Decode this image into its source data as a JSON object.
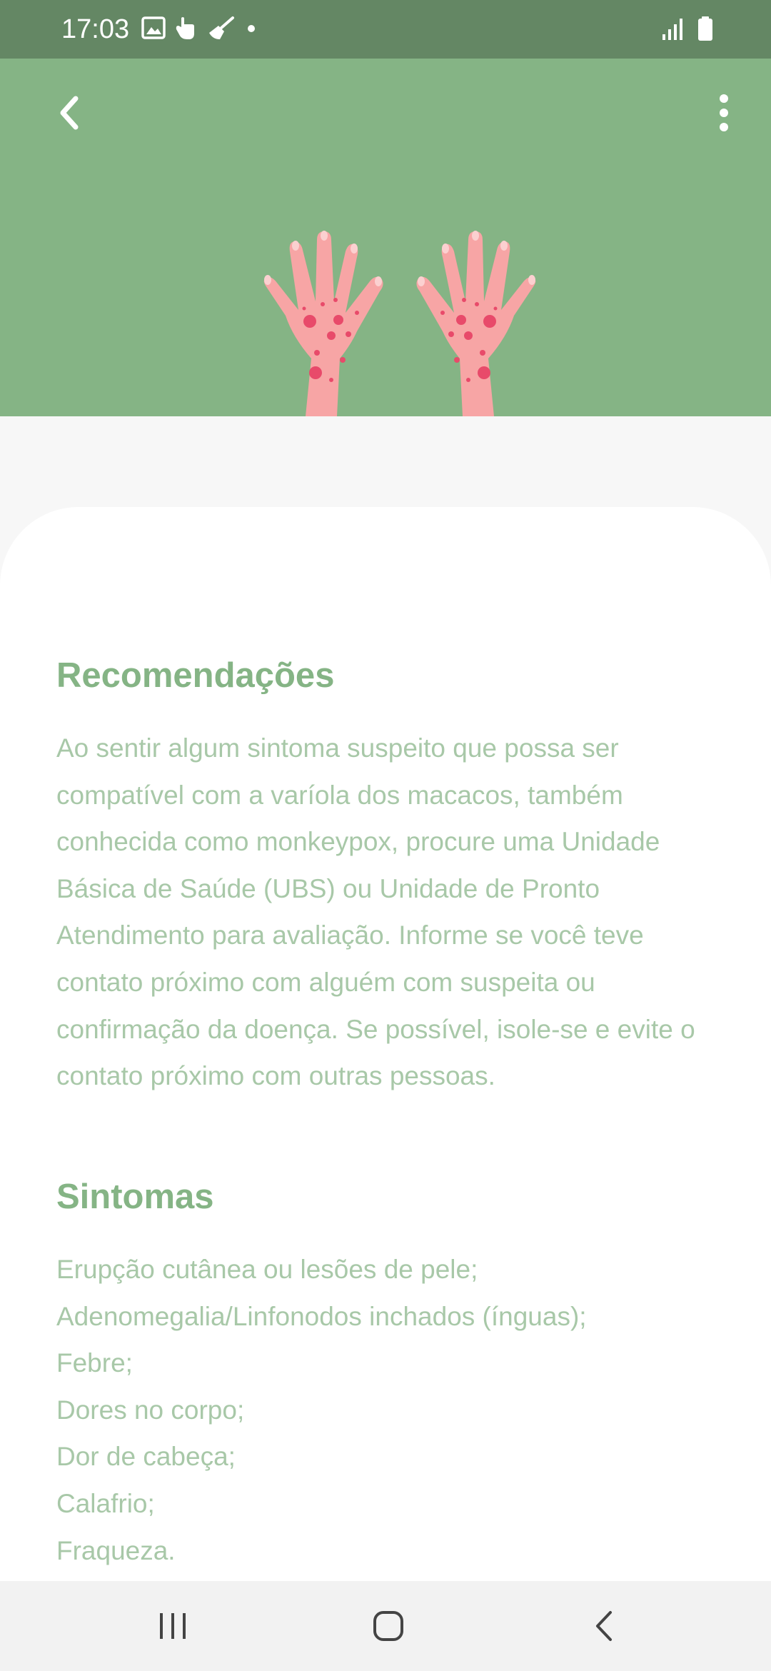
{
  "status_bar": {
    "time": "17:03",
    "icons_left": [
      "image-icon",
      "hand-icon",
      "broom-icon",
      "dot-icon"
    ],
    "icons_right": [
      "signal-icon",
      "battery-icon"
    ]
  },
  "header": {
    "back_icon": "chevron-left-icon",
    "menu_icon": "more-vertical-icon",
    "illustration": "hands-with-rash-illustration"
  },
  "recommendations": {
    "title": "Recomendações",
    "body": "Ao sentir algum sintoma suspeito que possa ser compatível com a varíola dos macacos, também conhecida como monkeypox, procure uma Unidade Básica de Saúde (UBS) ou Unidade de Pronto Atendimento para avaliação. Informe se você teve contato próximo com alguém com suspeita ou confirmação da doença. Se possível, isole-se e evite o contato próximo com outras pessoas."
  },
  "symptoms": {
    "title": "Sintomas",
    "items": [
      "Erupção cutânea ou lesões de pele;",
      "Adenomegalia/Linfonodos inchados (ínguas);",
      "Febre;",
      "Dores no corpo;",
      "Dor de cabeça;",
      "Calafrio;",
      "Fraqueza."
    ]
  },
  "nav_bar": {
    "buttons": [
      "recents-icon",
      "home-icon",
      "back-icon"
    ]
  },
  "colors": {
    "status_bar": "#648764",
    "header": "#85b485",
    "title": "#85b485",
    "body_text": "#a8c8a8",
    "hand_skin": "#f7a5a5",
    "rash": "#e84a6a"
  }
}
